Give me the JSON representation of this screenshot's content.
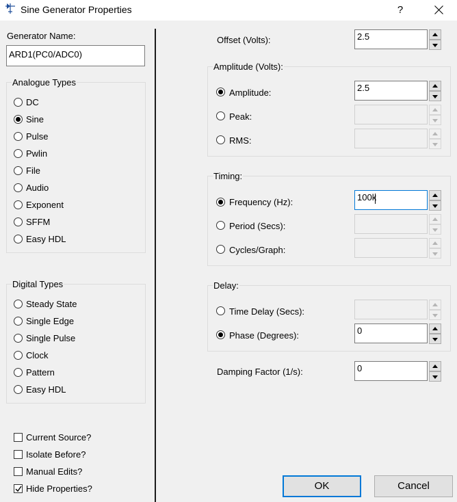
{
  "window": {
    "title": "Sine Generator Properties",
    "help_label": "?"
  },
  "generator": {
    "name_label": "Generator Name:",
    "name_value": "ARD1(PC0/ADC0)"
  },
  "analogue": {
    "title": "Analogue Types",
    "items": [
      "DC",
      "Sine",
      "Pulse",
      "Pwlin",
      "File",
      "Audio",
      "Exponent",
      "SFFM",
      "Easy HDL"
    ],
    "selected": "Sine"
  },
  "digital": {
    "title": "Digital Types",
    "items": [
      "Steady State",
      "Single Edge",
      "Single Pulse",
      "Clock",
      "Pattern",
      "Easy HDL"
    ]
  },
  "options": {
    "current_source": {
      "label": "Current Source?",
      "checked": false
    },
    "isolate_before": {
      "label": "Isolate Before?",
      "checked": false
    },
    "manual_edits": {
      "label": "Manual Edits?",
      "checked": false
    },
    "hide_properties": {
      "label": "Hide Properties?",
      "checked": true
    }
  },
  "offset": {
    "label": "Offset (Volts):",
    "value": "2.5"
  },
  "amplitude_group": {
    "title": "Amplitude (Volts):",
    "amplitude": {
      "label": "Amplitude:",
      "value": "2.5",
      "selected": true
    },
    "peak": {
      "label": "Peak:",
      "value": ""
    },
    "rms": {
      "label": "RMS:",
      "value": ""
    }
  },
  "timing_group": {
    "title": "Timing:",
    "frequency": {
      "label": "Frequency (Hz):",
      "value": "100k",
      "selected": true
    },
    "period": {
      "label": "Period (Secs):",
      "value": ""
    },
    "cycles": {
      "label": "Cycles/Graph:",
      "value": ""
    }
  },
  "delay_group": {
    "title": "Delay:",
    "time_delay": {
      "label": "Time Delay (Secs):",
      "value": ""
    },
    "phase": {
      "label": "Phase (Degrees):",
      "value": "0",
      "selected": true
    }
  },
  "damping": {
    "label": "Damping Factor (1/s):",
    "value": "0"
  },
  "buttons": {
    "ok": "OK",
    "cancel": "Cancel"
  }
}
